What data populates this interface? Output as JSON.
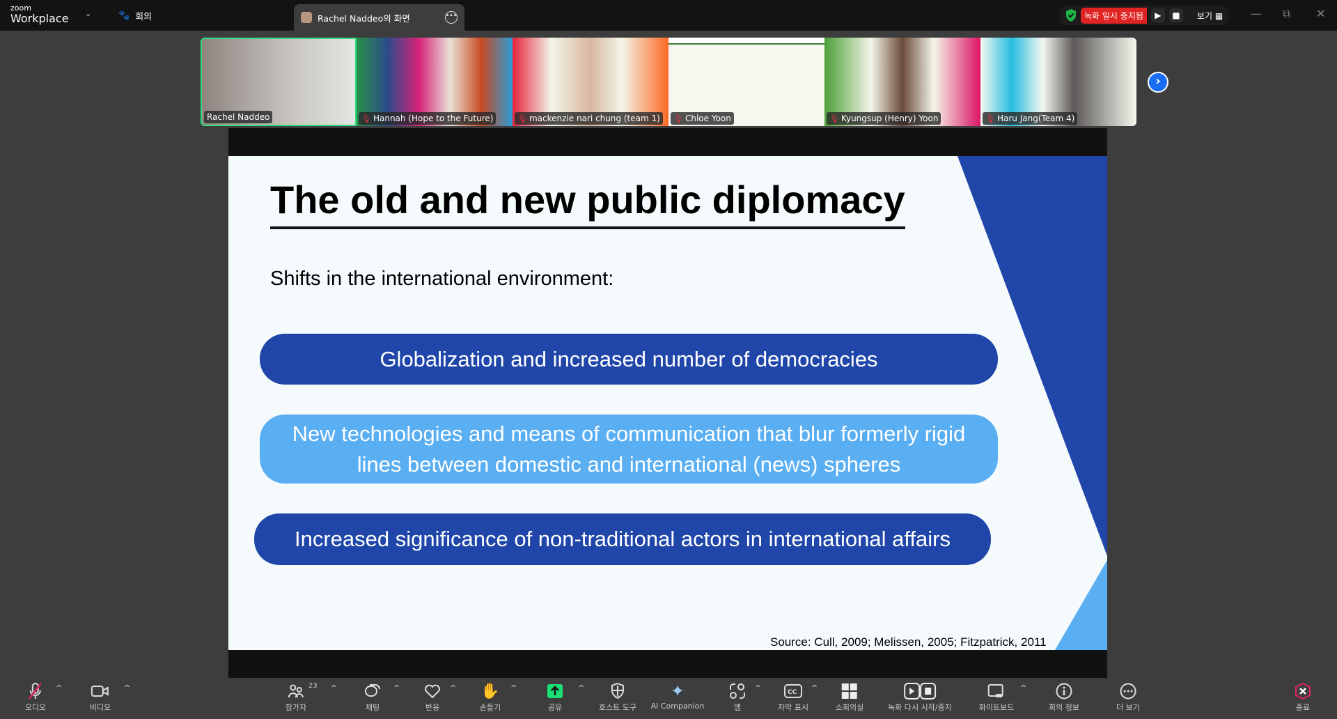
{
  "app": {
    "logo_small": "zoom",
    "logo_big": "Workplace",
    "meeting_label": "회의",
    "share_tab": "Rachel Naddeo의 화면",
    "recording_status": "녹화 일시 중지됨",
    "view_label": "보기"
  },
  "colors": {
    "slide_dark_blue": "#1f46a8",
    "slide_light_blue": "#5aaef2",
    "record_red": "#e02424",
    "share_green": "#1adf74",
    "end_red": "#e0245e",
    "active_speaker": "#2ee07f"
  },
  "participants": [
    {
      "name": "Rachel Naddeo",
      "muted": false,
      "active": true
    },
    {
      "name": "Hannah (Hope to the Future)",
      "muted": true
    },
    {
      "name": "mackenzie nari chung (team 1)",
      "muted": true
    },
    {
      "name": "Chloe Yoon",
      "muted": true
    },
    {
      "name": "Kyungsup (Henry) Yoon",
      "muted": true
    },
    {
      "name": "Haru Jang(Team 4)",
      "muted": true
    }
  ],
  "slide": {
    "title": "The old and new public diplomacy",
    "subtitle": "Shifts in the international environment:",
    "points": [
      "Globalization and increased number of democracies",
      "New technologies and means of communication that blur formerly rigid lines between domestic and international (news) spheres",
      "Increased significance of non-traditional actors in international affairs"
    ],
    "source": "Source: Cull, 2009; Melissen, 2005; Fitzpatrick, 2011"
  },
  "toolbar": {
    "audio": "오디오",
    "video": "비디오",
    "participants": "참가자",
    "participant_count": "23",
    "chat": "채팅",
    "reactions": "반응",
    "raise_hand": "손들기",
    "share": "공유",
    "host_tools": "호스트 도구",
    "ai_companion": "AI Companion",
    "apps": "앱",
    "captions": "자막 표시",
    "breakout": "소회의실",
    "recording": "녹화 다시 시작/중지",
    "whiteboard": "화이트보드",
    "meeting_info": "회의 정보",
    "more": "더 보기",
    "end": "종료"
  }
}
